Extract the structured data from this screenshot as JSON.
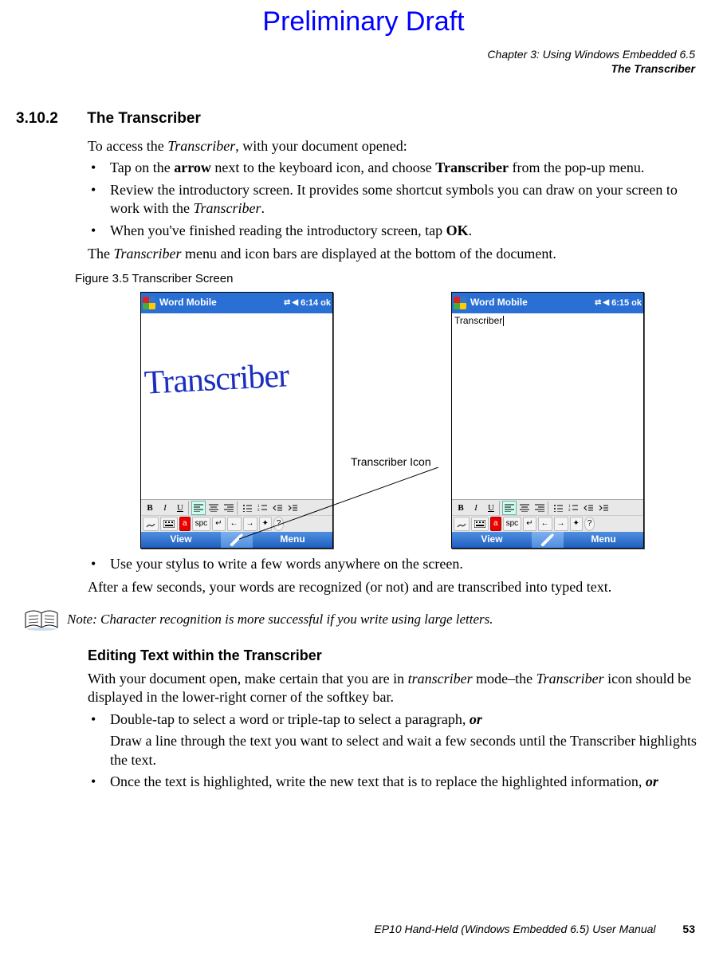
{
  "preliminary": "Preliminary Draft",
  "header": {
    "chapter": "Chapter 3: Using Windows Embedded 6.5",
    "section_title": "The Transcriber"
  },
  "section": {
    "number": "3.10.2",
    "title": "The Transcriber"
  },
  "intro_sentence_parts": {
    "p1a": "To access the ",
    "p1b": "Transcriber",
    "p1c": ", with your document opened:"
  },
  "bullets1": {
    "b1a": "Tap on the ",
    "b1b": "arrow",
    "b1c": " next to the keyboard icon, and choose ",
    "b1d": "Transcriber",
    "b1e": " from the pop-up menu.",
    "b2a": "Review the introductory screen. It provides some shortcut symbols you can draw on your screen to work with the ",
    "b2b": "Transcriber",
    "b2c": ".",
    "b3a": "When you've finished reading the introductory screen, tap ",
    "b3b": "OK",
    "b3c": "."
  },
  "post_bullet_parts": {
    "a": "The ",
    "b": "Transcriber",
    "c": " menu and icon bars are displayed at the bottom of the document."
  },
  "figure_caption": "Figure 3.5  Transcriber Screen",
  "callout": "Transcriber Icon",
  "device_left": {
    "title": "Word Mobile",
    "time": "6:14",
    "ok": "ok",
    "handwriting": "Transcriber",
    "softkey_left": "View",
    "softkey_right": "Menu"
  },
  "device_right": {
    "title": "Word Mobile",
    "time": "6:15",
    "ok": "ok",
    "typed": "Transcriber",
    "softkey_left": "View",
    "softkey_right": "Menu"
  },
  "toolbar_labels": {
    "bold": "B",
    "italic": "I",
    "underline": "U",
    "a": "a",
    "spc": "spc",
    "ent": "↵",
    "left": "←",
    "right": "→",
    "gear": "✦",
    "help": "?"
  },
  "after_fig": {
    "bullet": "Use your stylus to write a few words anywhere on the screen.",
    "para": "After a few seconds, your words are recognized (or not) and are transcribed into typed text."
  },
  "note": "Note: Character recognition is more successful if you write using large letters.",
  "subheading": "Editing Text within the Transcriber",
  "edit_para_parts": {
    "a": "With your document open, make certain that you are in ",
    "b": "transcriber",
    "c": " mode–the ",
    "d": "Transcriber",
    "e": " icon should be displayed in the lower-right corner of the softkey bar."
  },
  "bullets2": {
    "b1a": "Double-tap to select a word or triple-tap to select a paragraph, ",
    "b1b": "or",
    "b1sub": "Draw a line through the text you want to select and wait a few seconds until the Transcriber highlights the text.",
    "b2a": "Once the text is highlighted, write the new text that is to replace the highlighted information, ",
    "b2b": "or"
  },
  "footer": {
    "manual": "EP10 Hand-Held (Windows Embedded 6.5) User Manual",
    "page": "53"
  }
}
